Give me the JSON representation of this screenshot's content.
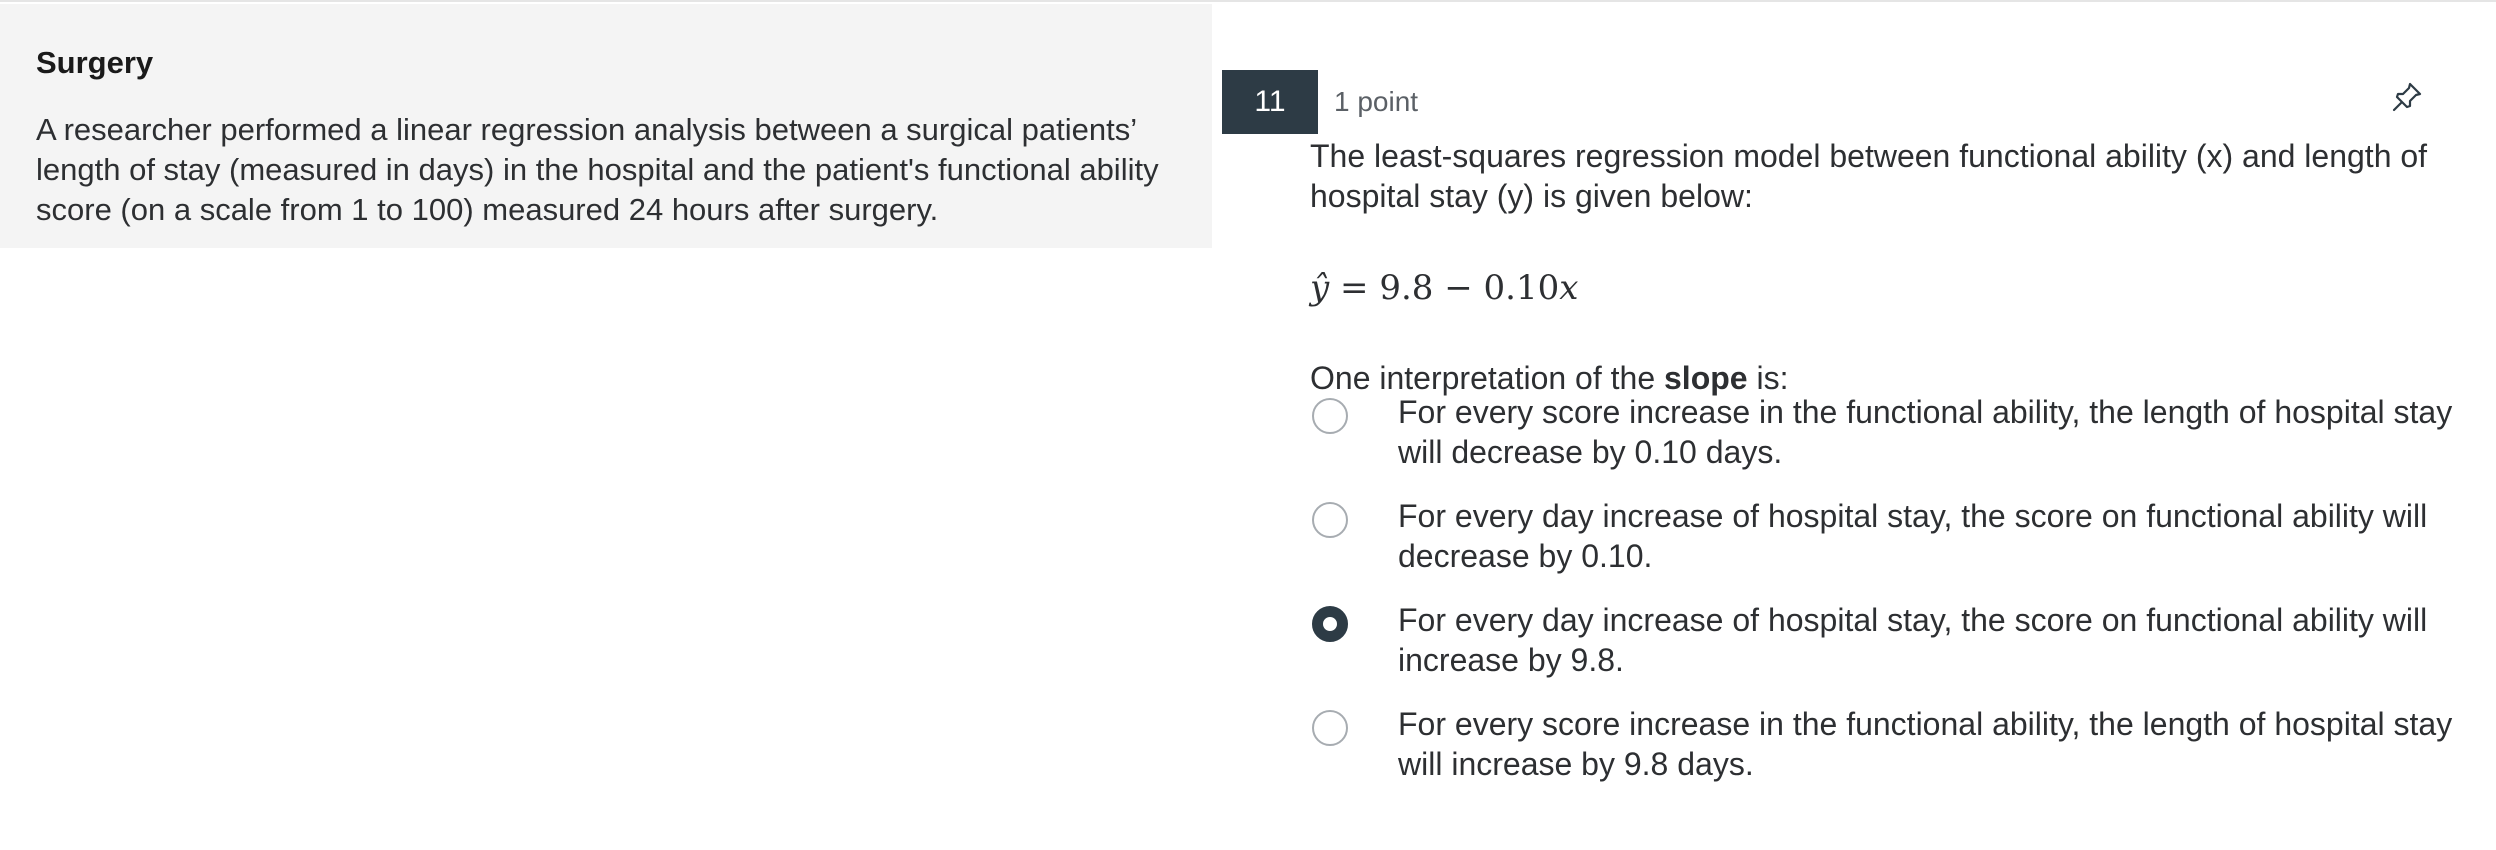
{
  "stimulus": {
    "title": "Surgery",
    "text": "A researcher performed a linear regression analysis between a surgical patients’ length of stay (measured in days) in the hospital and the patient's functional ability score (on a scale from 1 to 100) measured 24 hours after surgery."
  },
  "question": {
    "number": "11",
    "points": "1 point",
    "prompt": "The least-squares regression model between functional ability (x) and length of hospital stay (y) is given below:",
    "equation": {
      "lhs": "ŷ",
      "eq": "=",
      "rhs_const": "9.8",
      "minus": "−",
      "rhs_coef": "0.10",
      "rhs_var": "x"
    },
    "lead_prefix": "One interpretation of the ",
    "lead_bold": "slope",
    "lead_suffix": " is:",
    "options": [
      {
        "text": "For every score increase in the functional ability, the length of hospital stay will decrease by 0.10 days.",
        "selected": false
      },
      {
        "text": "For every day increase of hospital stay, the score on functional ability will decrease by 0.10.",
        "selected": false
      },
      {
        "text": "For every day increase of hospital stay, the score on functional ability will increase by 9.8.",
        "selected": true
      },
      {
        "text": "For every score increase in the functional ability, the length of hospital stay will increase by 9.8 days.",
        "selected": false
      }
    ]
  },
  "icons": {
    "pin": "pin-icon"
  },
  "colors": {
    "stimulus_bg": "#f4f4f4",
    "number_badge_bg": "#2d3b45",
    "radio_selected": "#2d3b45"
  }
}
